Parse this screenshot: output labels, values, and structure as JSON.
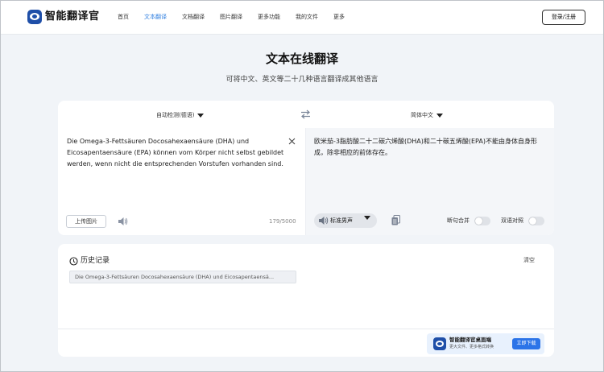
{
  "header": {
    "brand": "智能翻译官",
    "nav": [
      "首页",
      "文本翻译",
      "文档翻译",
      "图片翻译",
      "更多功能",
      "我的文件",
      "更多"
    ],
    "active_nav": "文本翻译",
    "login_label": "登录/注册"
  },
  "hero": {
    "title": "文本在线翻译",
    "subtitle": "可将中文、英文等二十几种语言翻译成其他语言"
  },
  "translator": {
    "source_language": "自动检测(德语)",
    "target_language": "简体中文",
    "source_text": "Die Omega-3-Fettsäuren Docosahexaensäure (DHA) und Eicosapentaensäure (EPA) können vom Körper nicht selbst gebildet werden, wenn nicht die entsprechenden Vorstufen vorhanden sind.",
    "translated_text": "欧米茄-3脂肪酸二十二碳六烯酸(DHA)和二十碳五烯酸(EPA)不能由身体自身形成，除非相应的前体存在。",
    "upload_label": "上传图片",
    "char_count": "179/5000",
    "voice_label": "标准男声",
    "toggle_merge_label": "断句合并",
    "toggle_bilingual_label": "双语对照"
  },
  "history": {
    "title": "历史记录",
    "clear_label": "清空",
    "items": [
      "Die Omega-3-Fettsäuren Docosahexaensäure (DHA) und Eicosapentaensä..."
    ]
  },
  "promo": {
    "title": "智能翻译官桌面端",
    "subtitle": "更大文件、更多格式转换",
    "button_label": "立即下载"
  },
  "colors": {
    "accent": "#2f7fe0",
    "brand": "#1f4fa8",
    "background": "#f1f4f8"
  }
}
